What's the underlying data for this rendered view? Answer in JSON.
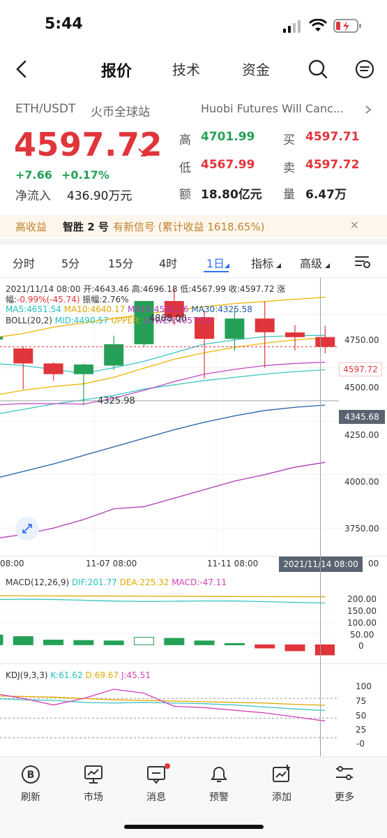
{
  "status_bar": {
    "time": "5:44"
  },
  "nav": {
    "tabs": [
      {
        "label": "报价"
      },
      {
        "label": "技术"
      },
      {
        "label": "资金"
      }
    ]
  },
  "ticker": {
    "pair": "ETH/USDT",
    "exchange": "火币全球站",
    "news": "Huobi Futures Will Canc...",
    "price": "4597.72",
    "change_abs": "+7.66",
    "change_pct": "+0.17%",
    "net_inflow_label": "净流入",
    "net_inflow_value": "436.90万元",
    "stats": {
      "high_label": "高",
      "high": "4701.99",
      "low_label": "低",
      "low": "4567.99",
      "amount_label": "额",
      "amount": "18.80亿元",
      "buy_label": "买",
      "buy": "4597.71",
      "sell_label": "卖",
      "sell": "4597.72",
      "volume_label": "量",
      "volume": "6.47万"
    }
  },
  "banner": {
    "tag": "高收益",
    "product": "智胜 2 号",
    "signal": "有新信号 (累计收益 1618.65%)"
  },
  "intervals": [
    {
      "label": "分时"
    },
    {
      "label": "5分"
    },
    {
      "label": "15分"
    },
    {
      "label": "4时"
    },
    {
      "label": "1日"
    },
    {
      "label": "指标"
    },
    {
      "label": "高级"
    }
  ],
  "main_chart": {
    "info_line1": "2021/11/14 08:00 开:4643.46 高:4696.18 低:4567.99 收:4597.72 涨",
    "info_line2_prefix": "幅:",
    "info_line2_change": "-0.99%(-45.74)",
    "info_line2_suffix": " 振幅:2.76%",
    "ma5": "MA5:4651.54",
    "ma10": "MA10:4640.17",
    "ma15": "MA15:4582.16",
    "ma30": "MA30:4325.58",
    "boll": "BOLL(20,2)",
    "boll_mid": "MID:4490.57",
    "boll_upper": "UPPER:",
    "boll_lower": "LOWER:4057.51",
    "high_marker": "4868.00",
    "low_marker": "4325.98",
    "last_price_tag": "4597.72",
    "crosshair_price_tag": "4345.68",
    "date_labels": [
      "08:00",
      "11-07 08:00",
      "11-11 08:00"
    ],
    "crosshair_date": "2021/11/14 08:00",
    "colors": {
      "up": "#24a157",
      "down": "#e0353b",
      "ma5": "#e0a800",
      "ma10": "#f0b400",
      "ma15": "#b03ab8",
      "ma30": "#1f5fa8",
      "boll_mid": "#3cc4c4"
    }
  },
  "macd": {
    "title": "MACD(12,26,9)",
    "dif": "DIF:201.77",
    "dea": "DEA:225.32",
    "macd": "MACD:-47.11",
    "axis": [
      "200.00",
      "150.00",
      "100.00",
      "50.00",
      "0"
    ]
  },
  "kdj": {
    "title": "KDJ(9,3,3)",
    "k": "K:61.62",
    "d": "D:69.67",
    "j": "J:45.51",
    "axis": [
      "100",
      "75",
      "50",
      "25",
      "-0"
    ]
  },
  "chart_data": {
    "type": "candlestick",
    "y_axis_ticks": [
      "4750.00",
      "4500.00",
      "4250.00",
      "4000.00",
      "3750.00"
    ],
    "ylim": [
      3620,
      4920
    ],
    "candles": [
      {
        "o": 4632,
        "h": 4660,
        "l": 4590,
        "c": 4645
      },
      {
        "o": 4590,
        "h": 4600,
        "l": 4400,
        "c": 4520
      },
      {
        "o": 4520,
        "h": 4525,
        "l": 4440,
        "c": 4470
      },
      {
        "o": 4470,
        "h": 4520,
        "l": 4325.98,
        "c": 4515
      },
      {
        "o": 4510,
        "h": 4650,
        "l": 4490,
        "c": 4610
      },
      {
        "o": 4610,
        "h": 4812,
        "l": 4600,
        "c": 4812
      },
      {
        "o": 4812,
        "h": 4868,
        "l": 4700,
        "c": 4736
      },
      {
        "o": 4736,
        "h": 4768,
        "l": 4450,
        "c": 4635
      },
      {
        "o": 4635,
        "h": 4780,
        "l": 4580,
        "c": 4730
      },
      {
        "o": 4730,
        "h": 4810,
        "l": 4500,
        "c": 4666
      },
      {
        "o": 4665,
        "h": 4700,
        "l": 4580,
        "c": 4643
      },
      {
        "o": 4643.46,
        "h": 4696.18,
        "l": 4567.99,
        "c": 4597.72
      }
    ],
    "ma5": [
      4520,
      4510,
      4492,
      4474,
      4500,
      4530,
      4570,
      4610,
      4630,
      4645,
      4650,
      4651.54
    ],
    "ma10": [
      4370,
      4395,
      4412,
      4425,
      4455,
      4498,
      4540,
      4570,
      4595,
      4615,
      4630,
      4640.17
    ],
    "boll_mid": [
      4280,
      4305,
      4330,
      4350,
      4370,
      4400,
      4420,
      4440,
      4455,
      4470,
      4482,
      4490.57
    ],
    "ma30": [
      3980,
      4015,
      4050,
      4090,
      4130,
      4170,
      4210,
      4245,
      4275,
      4300,
      4315,
      4325.58
    ],
    "boll_lower": [
      3700,
      3720,
      3750,
      3790,
      3840,
      3850,
      3890,
      3930,
      3970,
      4000,
      4035,
      4057.51
    ],
    "boll_upper": [
      4640,
      4660,
      4690,
      4710,
      4730,
      4750,
      4770,
      4785,
      4800,
      4810,
      4820,
      4830
    ],
    "macd_hist": [
      45,
      38,
      22,
      20,
      18,
      35,
      30,
      18,
      6,
      -15,
      -28,
      -47.11
    ],
    "macd_ylim": [
      -80,
      270
    ],
    "kdj_k": [
      80,
      78,
      77,
      74,
      73,
      74,
      73,
      72,
      70,
      67,
      64,
      61.62
    ],
    "kdj_d": [
      84,
      83,
      82,
      80,
      78,
      77,
      76,
      75,
      74,
      73,
      71,
      69.67
    ],
    "kdj_j": [
      88,
      80,
      70,
      80,
      94,
      88,
      68,
      66,
      62,
      58,
      52,
      45.51
    ],
    "kdj_ylim": [
      -5,
      110
    ]
  },
  "bottom_nav": [
    {
      "label": "刷新",
      "icon": "refresh-b-icon"
    },
    {
      "label": "市场",
      "icon": "market-icon"
    },
    {
      "label": "消息",
      "icon": "message-icon"
    },
    {
      "label": "预警",
      "icon": "bell-icon"
    },
    {
      "label": "添加",
      "icon": "add-chart-icon"
    },
    {
      "label": "更多",
      "icon": "more-icon"
    }
  ]
}
